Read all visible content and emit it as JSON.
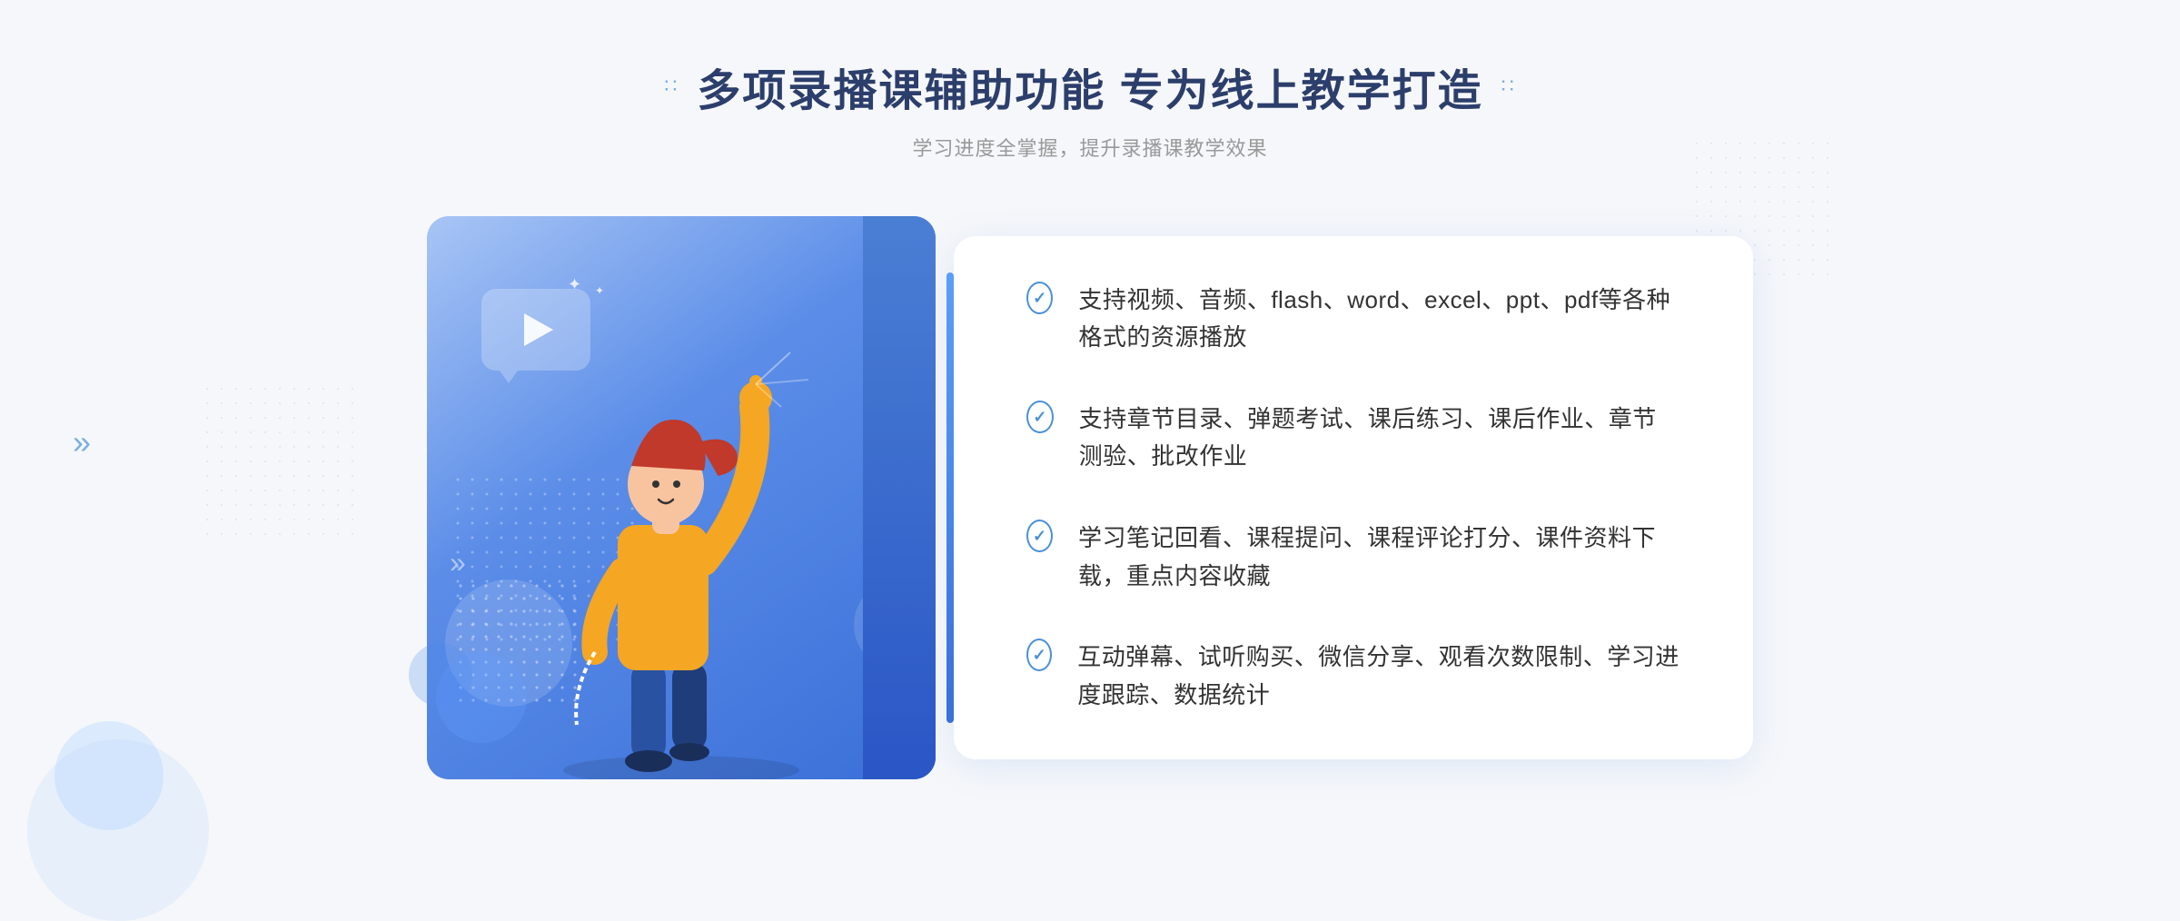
{
  "header": {
    "title": "多项录播课辅助功能 专为线上教学打造",
    "subtitle": "学习进度全掌握，提升录播课教学效果",
    "left_dots": "∷",
    "right_dots": "∷"
  },
  "chevrons": {
    "left": "»",
    "right_top": "∷"
  },
  "features": [
    {
      "id": 1,
      "text": "支持视频、音频、flash、word、excel、ppt、pdf等各种格式的资源播放"
    },
    {
      "id": 2,
      "text": "支持章节目录、弹题考试、课后练习、课后作业、章节测验、批改作业"
    },
    {
      "id": 3,
      "text": "学习笔记回看、课程提问、课程评论打分、课件资料下载，重点内容收藏"
    },
    {
      "id": 4,
      "text": "互动弹幕、试听购买、微信分享、观看次数限制、学习进度跟踪、数据统计"
    }
  ],
  "colors": {
    "primary_blue": "#4a90d9",
    "dark_blue": "#3a6fd8",
    "text_dark": "#2c3e6b",
    "text_gray": "#999999",
    "text_body": "#333333",
    "bg": "#f5f7fa",
    "white": "#ffffff"
  }
}
